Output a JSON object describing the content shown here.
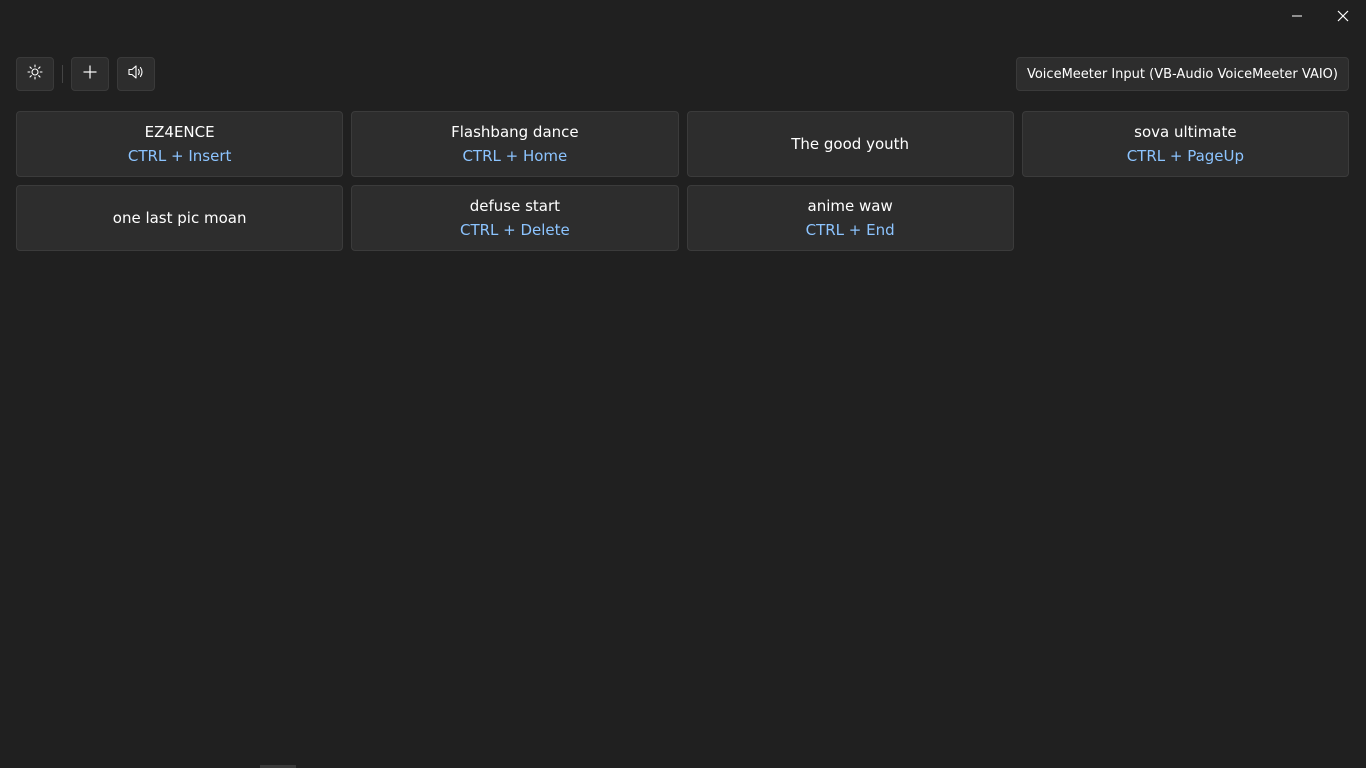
{
  "window": {
    "controls": {
      "minimize_icon": "minimize-icon",
      "close_icon": "close-icon"
    }
  },
  "toolbar": {
    "settings_icon": "sun-settings-icon",
    "add_icon": "plus-icon",
    "volume_icon": "speaker-icon",
    "output_device": "VoiceMeeter Input (VB-Audio VoiceMeeter VAIO)"
  },
  "sounds": [
    {
      "name": "EZ4ENCE",
      "hotkey": "CTRL + Insert"
    },
    {
      "name": "Flashbang dance",
      "hotkey": "CTRL + Home"
    },
    {
      "name": "The good youth",
      "hotkey": ""
    },
    {
      "name": "sova ultimate",
      "hotkey": "CTRL + PageUp"
    },
    {
      "name": "one last pic moan",
      "hotkey": ""
    },
    {
      "name": "defuse start",
      "hotkey": "CTRL + Delete"
    },
    {
      "name": "anime waw",
      "hotkey": "CTRL + End"
    }
  ],
  "colors": {
    "background": "#202020",
    "button": "#2d2d2d",
    "hotkey": "#8cc4ff"
  }
}
